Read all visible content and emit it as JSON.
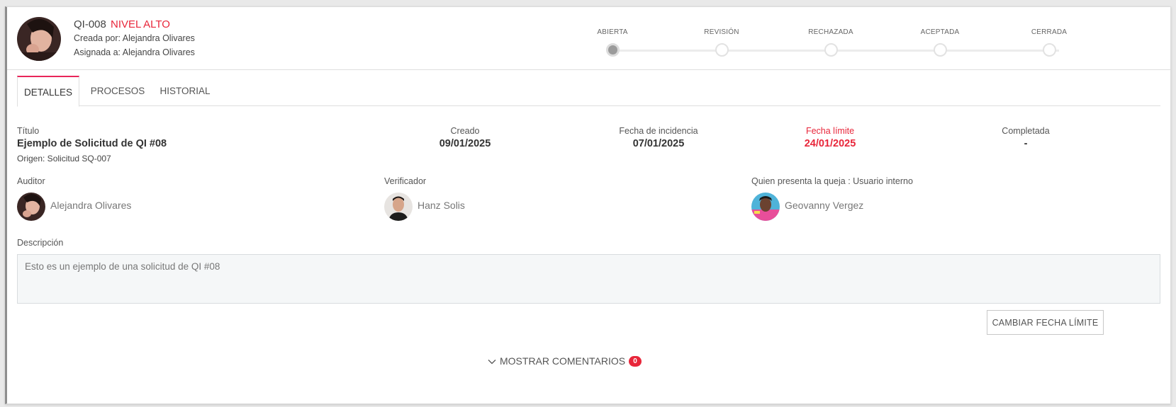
{
  "header": {
    "code": "QI-008",
    "level": "NIVEL ALTO",
    "created_by": "Creada por: Alejandra Olivares",
    "assigned_to": "Asignada a: Alejandra Olivares"
  },
  "stepper": {
    "steps": [
      {
        "label": "ABIERTA",
        "active": true
      },
      {
        "label": "REVISIÓN",
        "active": false
      },
      {
        "label": "RECHAZADA",
        "active": false
      },
      {
        "label": "ACEPTADA",
        "active": false
      },
      {
        "label": "CERRADA",
        "active": false
      }
    ]
  },
  "tabs": [
    {
      "label": "DETALLES",
      "active": true
    },
    {
      "label": "PROCESOS",
      "active": false
    },
    {
      "label": "HISTORIAL",
      "active": false
    }
  ],
  "details": {
    "title_label": "Título",
    "title_value": "Ejemplo de Solicitud de QI #08",
    "origin": "Origen: Solicitud SQ-007",
    "created_label": "Creado",
    "created_value": "09/01/2025",
    "incident_label": "Fecha de incidencia",
    "incident_value": "07/01/2025",
    "deadline_label": "Fecha límite",
    "deadline_value": "24/01/2025",
    "completed_label": "Completada",
    "completed_value": "-"
  },
  "people": {
    "auditor_label": "Auditor",
    "auditor_name": "Alejandra Olivares",
    "verifier_label": "Verificador",
    "verifier_name": "Hanz Solis",
    "complainant_label": "Quien presenta la queja : Usuario interno",
    "complainant_name": "Geovanny Vergez"
  },
  "description": {
    "label": "Descripción",
    "text": "Esto es un ejemplo de una solicitud de QI #08"
  },
  "actions": {
    "change_deadline": "CAMBIAR FECHA LÍMITE",
    "show_comments": "MOSTRAR COMENTARIOS",
    "comments_count": "0"
  },
  "colors": {
    "accent_red": "#e8263a",
    "tab_accent": "#e8265a"
  }
}
